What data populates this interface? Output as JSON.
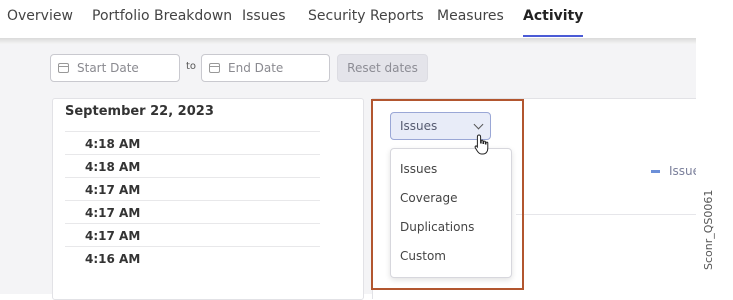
{
  "tabs": [
    {
      "label": "Overview",
      "active": false
    },
    {
      "label": "Portfolio Breakdown",
      "active": false
    },
    {
      "label": "Issues",
      "active": false
    },
    {
      "label": "Security Reports",
      "active": false
    },
    {
      "label": "Measures",
      "active": false
    },
    {
      "label": "Activity",
      "active": true
    }
  ],
  "filters": {
    "start_placeholder": "Start Date",
    "to_label": "to",
    "end_placeholder": "End Date",
    "reset_label": "Reset dates"
  },
  "activity": {
    "date": "September 22, 2023",
    "times": [
      "4:18 AM",
      "4:18 AM",
      "4:17 AM",
      "4:17 AM",
      "4:17 AM",
      "4:16 AM"
    ]
  },
  "graph_select": {
    "selected": "Issues",
    "options": [
      "Issues",
      "Coverage",
      "Duplications",
      "Custom"
    ]
  },
  "legend": {
    "label": "Issue",
    "color": "#6c8fd8"
  },
  "watermark": "Sconr_QS0061",
  "colors": {
    "accent": "#4b5bd6",
    "highlight": "#b2562f"
  }
}
